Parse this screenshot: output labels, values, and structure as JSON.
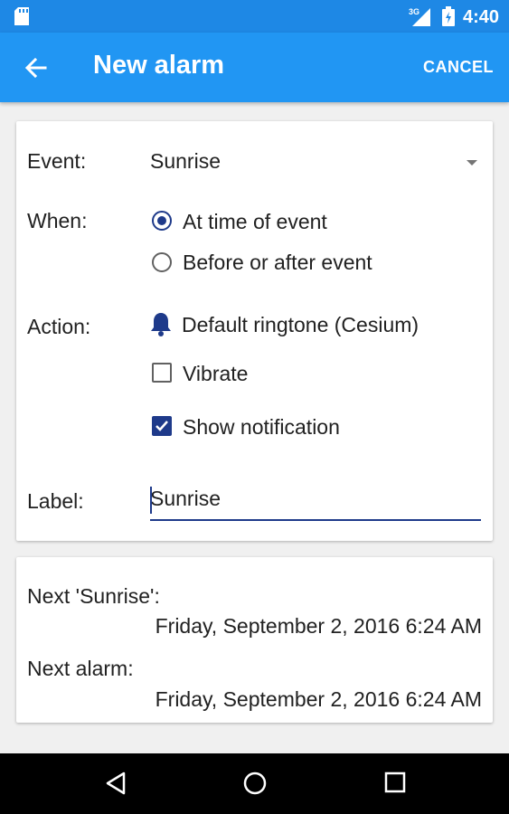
{
  "status_bar": {
    "time": "4:40",
    "network": "3G",
    "icons": [
      "sd-card-icon",
      "signal-icon",
      "battery-icon"
    ]
  },
  "app_bar": {
    "title": "New alarm",
    "cancel_label": "CANCEL",
    "back_icon": "arrow-back-icon",
    "color": "#2196f3"
  },
  "form": {
    "event_label": "Event:",
    "event_value": "Sunrise",
    "when_label": "When:",
    "when_options": [
      {
        "label": "At time of event",
        "selected": true
      },
      {
        "label": "Before or after event",
        "selected": false
      }
    ],
    "action_label": "Action:",
    "ringtone": "Default ringtone (Cesium)",
    "vibrate": {
      "label": "Vibrate",
      "checked": false
    },
    "show_notification": {
      "label": "Show notification",
      "checked": true
    },
    "label_label": "Label:",
    "label_value": "Sunrise"
  },
  "info": {
    "next_event_label": "Next 'Sunrise':",
    "next_event_value": "Friday, September 2, 2016 6:24 AM",
    "next_alarm_label": "Next alarm:",
    "next_alarm_value": "Friday, September 2, 2016 6:24 AM"
  },
  "nav_bar": {
    "icons": [
      "nav-back-icon",
      "nav-home-icon",
      "nav-recents-icon"
    ]
  },
  "colors": {
    "accent": "#1e3a8a",
    "primary": "#2196f3",
    "status_bar": "#1e88e5"
  }
}
